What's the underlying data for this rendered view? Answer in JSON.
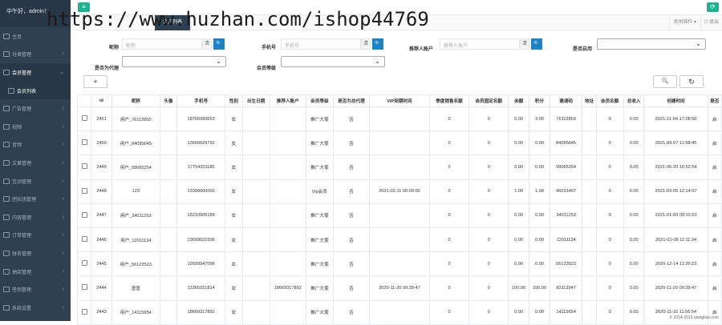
{
  "sidebar": {
    "user": "中午好，admin！",
    "items": [
      {
        "label": "主页",
        "chevron": ""
      },
      {
        "label": "分类管理",
        "chevron": "‹"
      },
      {
        "label": "会员管理",
        "chevron": "⌄"
      },
      {
        "label": "会员列表",
        "chevron": ""
      },
      {
        "label": "广告管理",
        "chevron": "‹"
      },
      {
        "label": "视频",
        "chevron": "‹"
      },
      {
        "label": "音频",
        "chevron": "‹"
      },
      {
        "label": "文章管理",
        "chevron": "‹"
      },
      {
        "label": "互动管理",
        "chevron": "‹"
      },
      {
        "label": "团长团管理",
        "chevron": "‹"
      },
      {
        "label": "内容管理",
        "chevron": "‹"
      },
      {
        "label": "订单管理",
        "chevron": "‹"
      },
      {
        "label": "财务管理",
        "chevron": "‹"
      },
      {
        "label": "抽奖管理",
        "chevron": "‹"
      },
      {
        "label": "签到管理",
        "chevron": "‹"
      },
      {
        "label": "系统设置",
        "chevron": "‹"
      }
    ]
  },
  "topbar": {
    "menu_icon": "≡",
    "refresh_icon": "⟳"
  },
  "tabs": {
    "active": "会员列表",
    "close_ops": "关闭操作 ▾",
    "exit": "⎋ 退出"
  },
  "watermark": "https://www.huzhan.com/ishop44769",
  "filters": {
    "nickname_label": "昵称",
    "nickname_placeholder": "昵称",
    "phone_label": "手机号",
    "phone_placeholder": "手机号",
    "referrer_label": "推荐人账户",
    "referrer_placeholder": "推荐人账户",
    "enabled_label": "是否启用",
    "is_agent_label": "是否为代理",
    "level_label": "会员等级",
    "clear_label": "清",
    "search_icon": "🔍"
  },
  "toolbar": {
    "add": "+",
    "search": "🔍",
    "refresh": "↻"
  },
  "table": {
    "headers": [
      "",
      "id",
      "昵称",
      "头像",
      "手机号",
      "性别",
      "出生日期",
      "推荐人账户",
      "会员等级",
      "是否为总代理",
      "VIP到期时间",
      "季度销售名额",
      "会员固定名额",
      "余额",
      "积分",
      "邀请码",
      "地址",
      "会员名额",
      "总收入",
      "创建时间",
      "是否"
    ],
    "rows": [
      [
        "",
        "2451",
        "用户_76112850",
        "",
        "18766583653",
        "女",
        "",
        "",
        "推广大使",
        "否",
        "",
        "0",
        "0",
        "0.00",
        "3.00",
        "76112850",
        "",
        "0",
        "0.00",
        "2021-11-04 17:28:50",
        "启"
      ],
      [
        "",
        "2450",
        "用户_84095645",
        "",
        "13666629792",
        "女",
        "",
        "",
        "推广大使",
        "否",
        "",
        "0",
        "0",
        "0.00",
        "0.00",
        "84095645",
        "",
        "0",
        "0.00",
        "2021-09-07 11:58:45",
        "启"
      ],
      [
        "",
        "2449",
        "用户_99065254",
        "",
        "17754331185",
        "女",
        "",
        "",
        "推广大使",
        "否",
        "",
        "0",
        "0",
        "0.00",
        "0.00",
        "99065254",
        "",
        "0",
        "0.00",
        "2021-06-20 16:52:54",
        "启"
      ],
      [
        "",
        "2448",
        "123",
        "",
        "13300000000",
        "女",
        "",
        "",
        "Vip会员",
        "否",
        "2021-03-11 00:00:00",
        "0",
        "0",
        "1.00",
        "1.00",
        "46031407",
        "",
        "0",
        "0.00",
        "2021-03-05 12:14:07",
        "启"
      ],
      [
        "",
        "2447",
        "用户_34011253",
        "",
        "15210905189",
        "女",
        "",
        "",
        "推广大使",
        "否",
        "",
        "0",
        "0",
        "0.00",
        "0.00",
        "34011253",
        "",
        "0",
        "0.00",
        "2021-01-09 09:12:53",
        "启"
      ],
      [
        "",
        "2446",
        "用户_12011134",
        "",
        "13693021696",
        "女",
        "",
        "",
        "推广大使",
        "否",
        "",
        "0",
        "0",
        "0.00",
        "0.00",
        "12011134",
        "",
        "0",
        "0.00",
        "2021-01-08 11:11:34",
        "启"
      ],
      [
        "",
        "2445",
        "用户_56123523",
        "",
        "19939947096",
        "女",
        "",
        "",
        "推广大使",
        "否",
        "",
        "0",
        "0",
        "0.00",
        "0.00",
        "56123523",
        "",
        "0",
        "0.00",
        "2020-12-14 11:35:23",
        "启"
      ],
      [
        "",
        "2444",
        "壹壹",
        "",
        "13365321814",
        "女",
        "",
        "18669317892",
        "推广大使",
        "否",
        "2020-11-20 09:39:47",
        "0",
        "0",
        "100.00",
        "100.00",
        "83113947",
        "",
        "0",
        "0.00",
        "2020-11-20 09:39:47",
        "启"
      ],
      [
        "",
        "2443",
        "用户_14115654",
        "",
        "18669317892",
        "女",
        "",
        "",
        "推广大使",
        "否",
        "",
        "0",
        "0",
        "0.00",
        "0.00",
        "14115654",
        "",
        "0",
        "0.00",
        "2020-11-16 11:56:54",
        "启"
      ]
    ]
  },
  "footer": "© 2014-2015 qiangkuo.com"
}
